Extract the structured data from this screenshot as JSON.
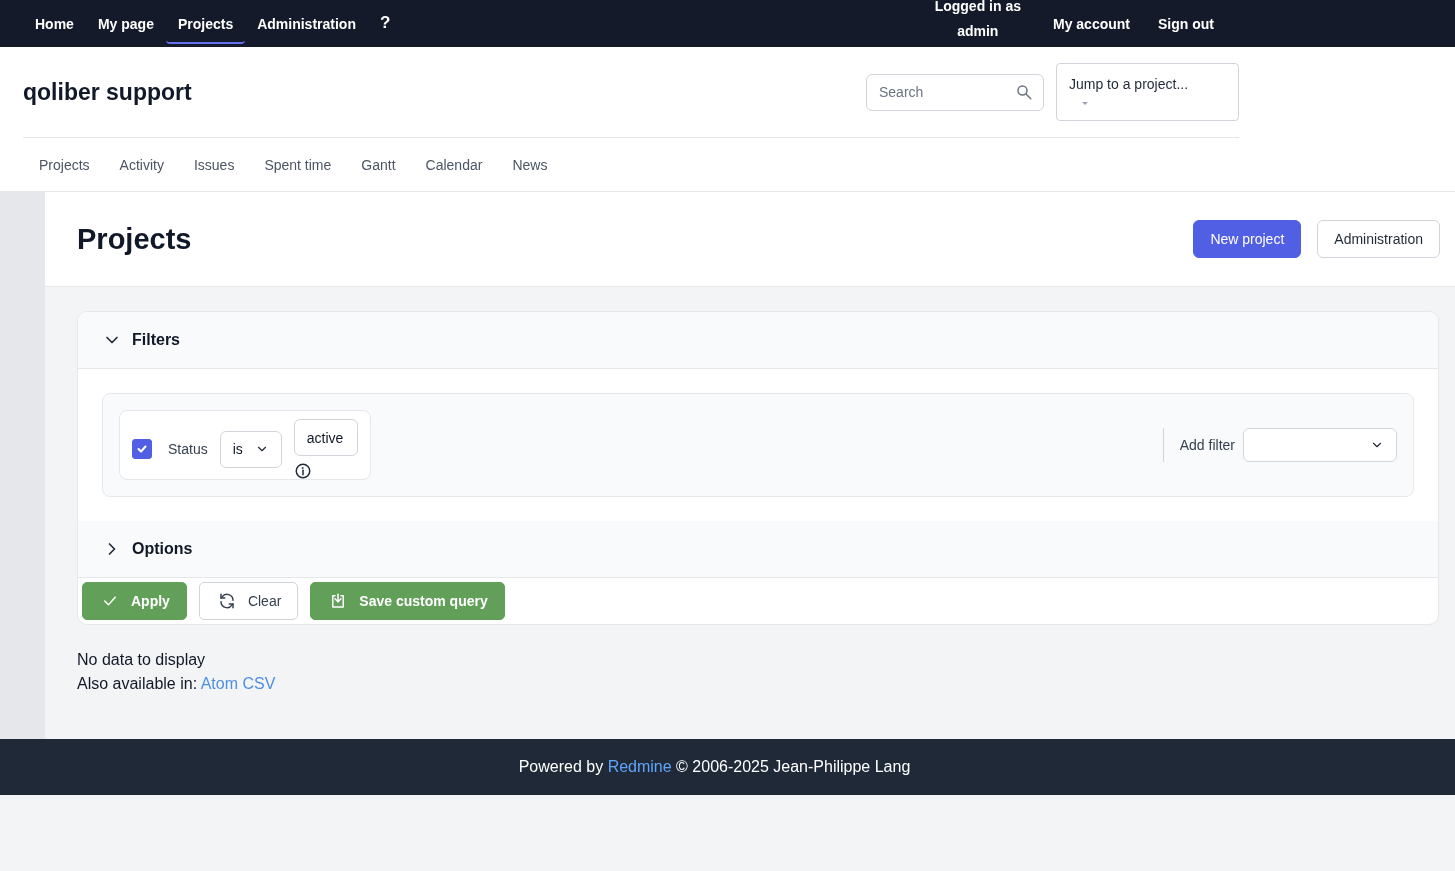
{
  "top_menu": {
    "items": [
      {
        "label": "Home",
        "selected": false
      },
      {
        "label": "My page",
        "selected": false
      },
      {
        "label": "Projects",
        "selected": true
      },
      {
        "label": "Administration",
        "selected": false
      }
    ],
    "help": "?"
  },
  "account": {
    "logged_in_as": "Logged in as",
    "user": "admin",
    "links": [
      "My account",
      "Sign out"
    ]
  },
  "header": {
    "title": "qoliber support",
    "search": {
      "placeholder": "Search"
    },
    "jump": "Jump to a project..."
  },
  "main_menu": [
    "Projects",
    "Activity",
    "Issues",
    "Spent time",
    "Gantt",
    "Calendar",
    "News"
  ],
  "page": {
    "title": "Projects",
    "actions": [
      {
        "label": "New project",
        "kind": "primary"
      },
      {
        "label": "Administration",
        "kind": "secondary"
      }
    ]
  },
  "filters": {
    "title": "Filters",
    "expanded": true,
    "rows": [
      {
        "checked": true,
        "label": "Status",
        "operator": "is",
        "value": "active"
      }
    ],
    "add_filter": "Add filter"
  },
  "options": {
    "title": "Options",
    "expanded": false
  },
  "buttons": [
    {
      "label": "Apply",
      "kind": "apply"
    },
    {
      "label": "Clear",
      "kind": "clear"
    },
    {
      "label": "Save custom query",
      "kind": "save"
    }
  ],
  "results": {
    "empty": "No data to display",
    "also": "Also available in:",
    "formats": [
      "Atom",
      "CSV"
    ]
  },
  "footer": {
    "before": "Powered by",
    "link": "Redmine",
    "after": "© 2006-2025 Jean-Philippe Lang"
  }
}
